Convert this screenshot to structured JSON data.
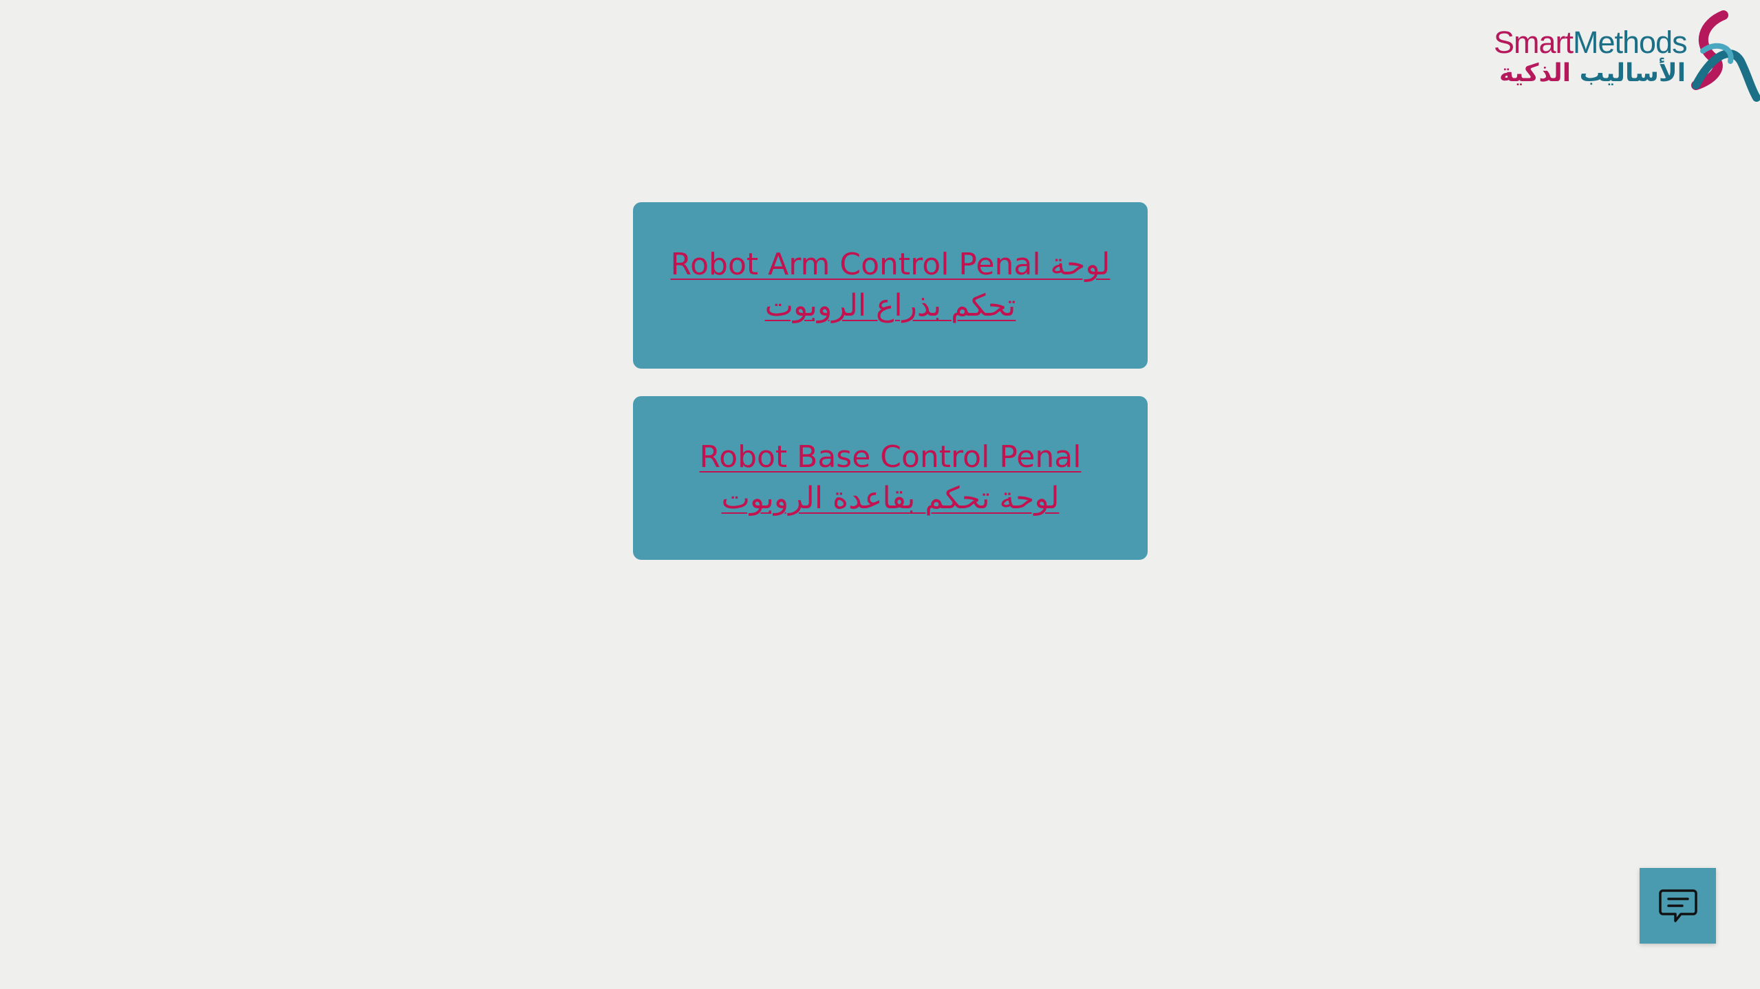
{
  "logo": {
    "en_smart": "Smart",
    "en_methods": "Methods",
    "ar_part1": "الأساليب",
    "ar_part2": "الذكية",
    "color_primary": "#b5195c",
    "color_secondary": "#1b6f87"
  },
  "panels": [
    {
      "label": "Robot Arm Control Penal لوحة تحكم بذراع الروبوت"
    },
    {
      "label": "Robot Base Control Penal لوحة تحكم بقاعدة الروبوت"
    }
  ],
  "chat": {
    "icon": "chat-bubble-icon"
  },
  "colors": {
    "background": "#efefed",
    "button_bg": "#4b9bb0",
    "link_text": "#c2124f"
  }
}
